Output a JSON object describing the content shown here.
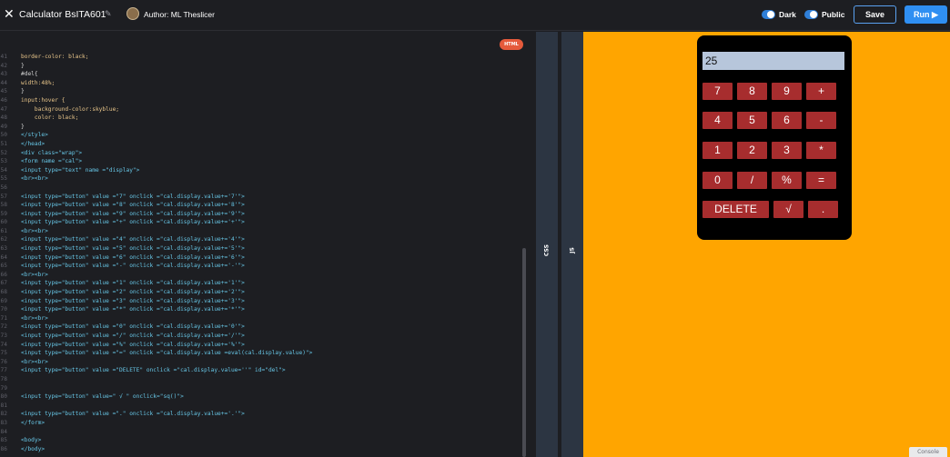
{
  "header": {
    "close_glyph": "✕",
    "title": "Calculator BsITA601",
    "pencil_glyph": "✎",
    "author": "Author: ML Theslicer",
    "dark_label": "Dark",
    "public_label": "Public",
    "save_label": "Save",
    "run_label": "Run ▶"
  },
  "editor": {
    "badge": "HTML",
    "lines": [
      [
        "41",
        "border-color: black;"
      ],
      [
        "42",
        "}"
      ],
      [
        "43",
        "#del{"
      ],
      [
        "44",
        "width:48%;"
      ],
      [
        "45",
        "}"
      ],
      [
        "46",
        "input:hover {"
      ],
      [
        "47",
        "    background-color:skyblue;"
      ],
      [
        "48",
        "    color: black;"
      ],
      [
        "49",
        "}"
      ],
      [
        "50",
        "</style>"
      ],
      [
        "51",
        "</head>"
      ],
      [
        "52",
        "<div class=\"wrap\">"
      ],
      [
        "53",
        "<form name =\"cal\">"
      ],
      [
        "54",
        "<input type=\"text\" name =\"display\">"
      ],
      [
        "55",
        "<br><br>"
      ],
      [
        "56",
        ""
      ],
      [
        "57",
        "<input type=\"button\" value =\"7\" onclick =\"cal.display.value+='7'\">"
      ],
      [
        "58",
        "<input type=\"button\" value =\"8\" onclick =\"cal.display.value+='8'\">"
      ],
      [
        "59",
        "<input type=\"button\" value =\"9\" onclick =\"cal.display.value+='9'\">"
      ],
      [
        "60",
        "<input type=\"button\" value =\"+\" onclick =\"cal.display.value+='+'\">"
      ],
      [
        "61",
        "<br><br>"
      ],
      [
        "62",
        "<input type=\"button\" value =\"4\" onclick =\"cal.display.value+='4'\">"
      ],
      [
        "63",
        "<input type=\"button\" value =\"5\" onclick =\"cal.display.value+='5'\">"
      ],
      [
        "64",
        "<input type=\"button\" value =\"6\" onclick =\"cal.display.value+='6'\">"
      ],
      [
        "65",
        "<input type=\"button\" value =\"-\" onclick =\"cal.display.value+='-'\">"
      ],
      [
        "66",
        "<br><br>"
      ],
      [
        "67",
        "<input type=\"button\" value =\"1\" onclick =\"cal.display.value+='1'\">"
      ],
      [
        "68",
        "<input type=\"button\" value =\"2\" onclick =\"cal.display.value+='2'\">"
      ],
      [
        "69",
        "<input type=\"button\" value =\"3\" onclick =\"cal.display.value+='3'\">"
      ],
      [
        "70",
        "<input type=\"button\" value =\"*\" onclick =\"cal.display.value+='*'\">"
      ],
      [
        "71",
        "<br><br>"
      ],
      [
        "72",
        "<input type=\"button\" value =\"0\" onclick =\"cal.display.value+='0'\">"
      ],
      [
        "73",
        "<input type=\"button\" value =\"/\" onclick =\"cal.display.value+='/'\">"
      ],
      [
        "74",
        "<input type=\"button\" value =\"%\" onclick =\"cal.display.value+='%'\">"
      ],
      [
        "75",
        "<input type=\"button\" value =\"=\" onclick =\"cal.display.value =eval(cal.display.value)\">"
      ],
      [
        "76",
        "<br><br>"
      ],
      [
        "77",
        "<input type=\"button\" value =\"DELETE\" onclick =\"cal.display.value=''\" id=\"del\">"
      ],
      [
        "78",
        ""
      ],
      [
        "79",
        ""
      ],
      [
        "80",
        "<input type=\"button\" value=\" √ \" onclick=\"sq()\">"
      ],
      [
        "81",
        ""
      ],
      [
        "82",
        "<input type=\"button\" value =\".\" onclick =\"cal.display.value+='.'\">"
      ],
      [
        "83",
        "</form>"
      ],
      [
        "84",
        ""
      ],
      [
        "85",
        "<body>"
      ],
      [
        "86",
        "</body>"
      ]
    ]
  },
  "panels": {
    "css_label": "CSS",
    "js_label": "JS"
  },
  "preview": {
    "display_value": "25",
    "keys": [
      "7",
      "8",
      "9",
      "+",
      "4",
      "5",
      "6",
      "-",
      "1",
      "2",
      "3",
      "*",
      "0",
      "/",
      "%",
      "=",
      "DELETE",
      "√",
      "."
    ]
  },
  "console_label": "Console"
}
